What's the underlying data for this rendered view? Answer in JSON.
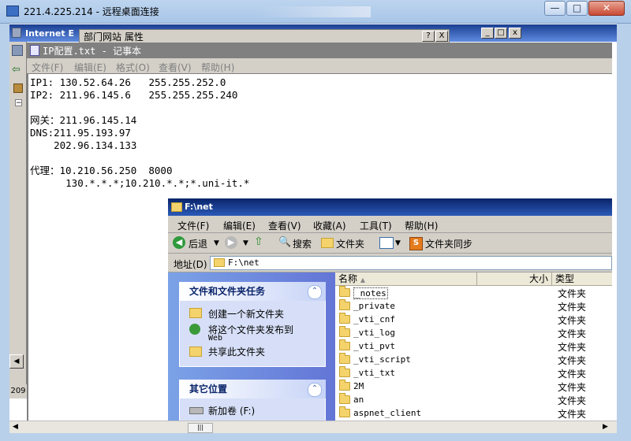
{
  "rdp": {
    "title": "221.4.225.214 - 远程桌面连接",
    "minimize": "—",
    "maximize": "□",
    "close": "✕"
  },
  "ie": {
    "title": "Internet E",
    "status_num": "209"
  },
  "properties": {
    "title": "部门网站 属性",
    "help": "?",
    "close": "X"
  },
  "notepad": {
    "title": "IP配置.txt - 记事本",
    "menu": [
      "文件(F)",
      "编辑(E)",
      "格式(O)",
      "查看(V)",
      "帮助(H)"
    ],
    "lines": [
      "IP1: 130.52.64.26   255.255.252.0",
      "IP2: 211.96.145.6   255.255.255.240",
      "",
      "网关：211.96.145.14",
      "DNS:211.95.193.97",
      "    202.96.134.133",
      "",
      "代理：10.210.56.250  8000",
      "      130.*.*.*;10.210.*.*;*.uni-it.*"
    ]
  },
  "explorer": {
    "title": "F:\\net",
    "menu": [
      "文件(F)",
      "编辑(E)",
      "查看(V)",
      "收藏(A)",
      "工具(T)",
      "帮助(H)"
    ],
    "toolbar": {
      "back": "后退",
      "search": "搜索",
      "folders": "文件夹",
      "folder_sync": "文件夹同步"
    },
    "address_label": "地址(D)",
    "address_value": "F:\\net",
    "tasks": {
      "title": "文件和文件夹任务",
      "items": [
        "创建一个新文件夹",
        "将这个文件夹发布到",
        "Web",
        "共享此文件夹"
      ]
    },
    "other": {
      "title": "其它位置",
      "items": [
        "新加卷 (F:)"
      ]
    },
    "columns": {
      "name": "名称",
      "size": "大小",
      "type": "类型"
    },
    "files": [
      {
        "name": "_notes",
        "type": "文件夹"
      },
      {
        "name": "_private",
        "type": "文件夹"
      },
      {
        "name": "_vti_cnf",
        "type": "文件夹"
      },
      {
        "name": "_vti_log",
        "type": "文件夹"
      },
      {
        "name": "_vti_pvt",
        "type": "文件夹"
      },
      {
        "name": "_vti_script",
        "type": "文件夹"
      },
      {
        "name": "_vti_txt",
        "type": "文件夹"
      },
      {
        "name": "2M",
        "type": "文件夹"
      },
      {
        "name": "an",
        "type": "文件夹"
      },
      {
        "name": "aspnet_client",
        "type": "文件夹"
      }
    ]
  }
}
